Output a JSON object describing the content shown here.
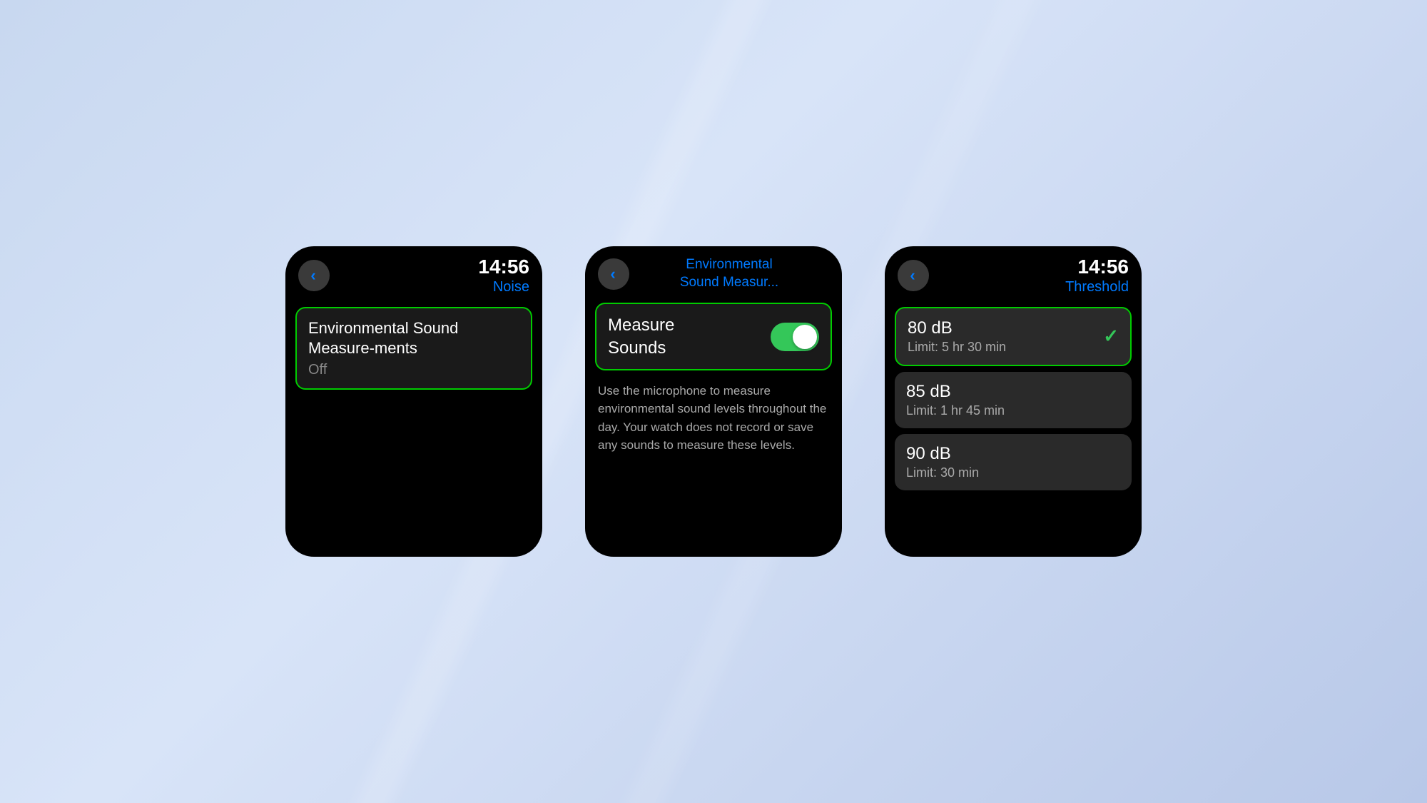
{
  "background": {
    "color": "#c8d8f0"
  },
  "screen1": {
    "time": "14:56",
    "title": "Noise",
    "back_label": "<",
    "menu_item": {
      "main_text": "Environmental Sound Measure-ments",
      "sub_text": "Off"
    }
  },
  "screen2": {
    "nav_title_line1": "Environmental",
    "nav_title_line2": "Sound Measur...",
    "back_label": "<",
    "toggle_label_line1": "Measure",
    "toggle_label_line2": "Sounds",
    "toggle_state": "on",
    "description": "Use the microphone to measure environmental sound levels throughout the day. Your watch does not record or save any sounds to measure these levels."
  },
  "screen3": {
    "time": "14:56",
    "title": "Threshold",
    "back_label": "<",
    "items": [
      {
        "db": "80 dB",
        "limit": "Limit: 5 hr 30 min",
        "selected": true
      },
      {
        "db": "85 dB",
        "limit": "Limit: 1 hr 45 min",
        "selected": false
      },
      {
        "db": "90 dB",
        "limit": "Limit: 30 min",
        "selected": false
      }
    ]
  }
}
